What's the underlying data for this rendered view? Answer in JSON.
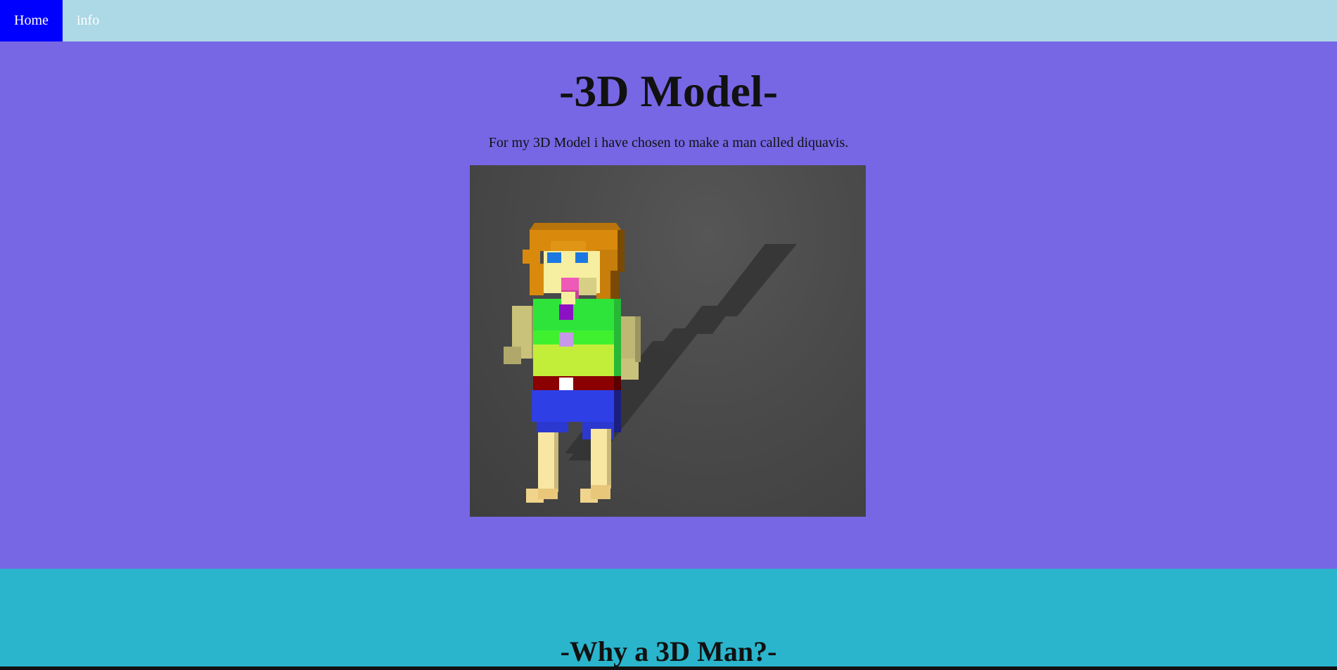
{
  "nav": {
    "items": [
      {
        "label": "Home",
        "active": true
      },
      {
        "label": "info",
        "active": false
      }
    ]
  },
  "hero": {
    "title": "-3D Model-",
    "description": "For my 3D Model i have chosen to make a man called diquavis."
  },
  "section_two": {
    "title": "-Why a 3D Man?-"
  },
  "colors": {
    "nav_bg": "#add8e6",
    "nav_active_bg": "#0000ff",
    "hero_bg": "#7767e4",
    "section_two_bg": "#2ab5cc"
  }
}
